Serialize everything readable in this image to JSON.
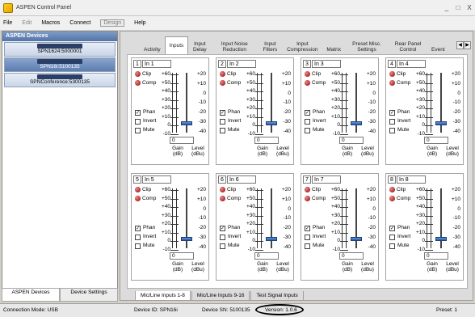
{
  "window": {
    "title": "ASPEN Control Panel",
    "minimize": "_",
    "maximize": "□",
    "close": "X"
  },
  "menu": {
    "items": [
      "File",
      "Edit",
      "Macros",
      "Connect",
      "Design",
      "Help"
    ]
  },
  "devices": {
    "header": "ASPEN Devices",
    "items": [
      {
        "name": "SPN1624:5000001"
      },
      {
        "name": "SPN16i:5100135"
      },
      {
        "name": "SPNConference:5300135"
      }
    ]
  },
  "left_footer": {
    "aspen": "ASPEN Devices",
    "settings": "Device Settings"
  },
  "tabs": [
    "Activity",
    "Inputs",
    "Input Delay",
    "Input Noise Reduction",
    "Input Filters",
    "Input Compression",
    "Matrix",
    "Preset Misc. Settings",
    "Rear Panel Control",
    "Events"
  ],
  "channels": [
    {
      "num": "1",
      "name": "In 1"
    },
    {
      "num": "2",
      "name": "In 2"
    },
    {
      "num": "3",
      "name": "In 3"
    },
    {
      "num": "4",
      "name": "In 4"
    },
    {
      "num": "5",
      "name": "In 5"
    },
    {
      "num": "6",
      "name": "In 6"
    },
    {
      "num": "7",
      "name": "In 7"
    },
    {
      "num": "8",
      "name": "In 8"
    }
  ],
  "strip_labels": {
    "clip": "Clip",
    "comp": "Comp",
    "phan": "Phan",
    "invert": "Invert",
    "mute": "Mute",
    "gain": "Gain (dB)",
    "level": "Level (dBu)",
    "gain_value": "0",
    "left_scale": [
      "+60",
      "+50",
      "+40",
      "+30",
      "+20",
      "+10",
      "0",
      "-10"
    ],
    "right_scale": [
      "+20",
      "+10",
      "0",
      "-10",
      "-20",
      "-30",
      "-40"
    ]
  },
  "bottom_tabs": [
    "Mic/Line Inputs 1-8",
    "Mic/Line Inputs 9-16",
    "Test Signal Inputs"
  ],
  "status": {
    "connection": "Connection Mode: USB",
    "device_id": "Device ID: SPN16i",
    "device_sn": "Device SN: 5100135",
    "version": "Version: 1.0.6",
    "preset": "Preset: 1"
  }
}
